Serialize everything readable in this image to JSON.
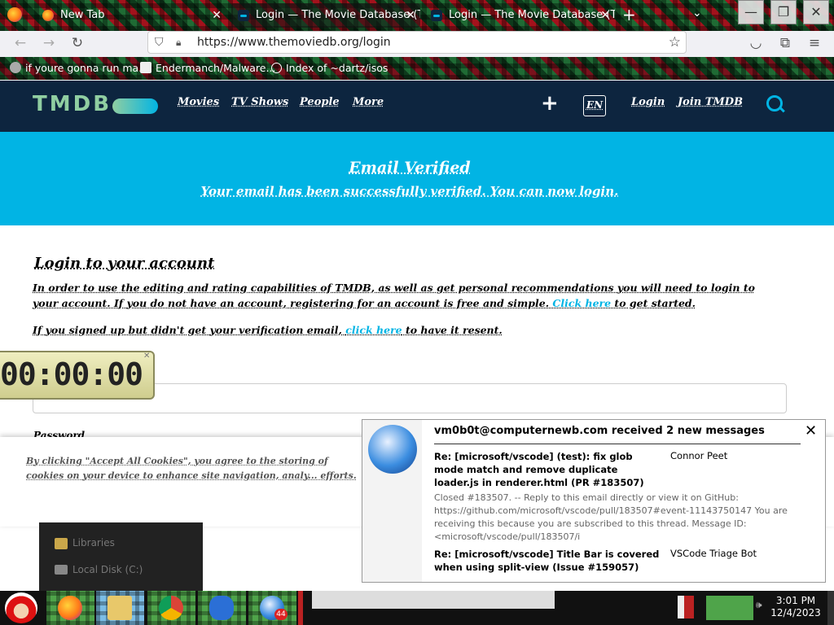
{
  "browser": {
    "tabs": [
      {
        "label": "New Tab",
        "icon": "firefox-icon"
      },
      {
        "label": "Login — The Movie Database (TMDB)",
        "icon": "tmdb-icon"
      },
      {
        "label": "Login — The Movie Database (TMDB)",
        "icon": "tmdb-icon"
      }
    ],
    "url": "https://www.themoviedb.org/login",
    "bookmarks": [
      {
        "label": "if youre gonna run ma..."
      },
      {
        "label": "Endermanch/Malware..."
      },
      {
        "label": "Index of ~dartz/isos"
      }
    ]
  },
  "site": {
    "logo": "TMDB",
    "nav": [
      "Movies",
      "TV Shows",
      "People",
      "More"
    ],
    "plus": "+",
    "lang": "EN",
    "login": "Login",
    "join": "Join TMDB"
  },
  "banner": {
    "title": "Email Verified",
    "message": "Your email has been successfully verified. You can now login."
  },
  "login": {
    "heading": "Login to your account",
    "desc_pre": "In order to use the editing and rating capabilities of TMDB, as well as get personal recommendations you will need to login to your account. If you do not have an account, registering for an account is free and simple.",
    "desc_link": "Click here",
    "desc_post": "to get started.",
    "resend_pre": "If you signed up but didn't get your verification email,",
    "resend_link": "click here",
    "resend_post": "to have it resent.",
    "password_label": "Password"
  },
  "cookie": {
    "text": "By clicking \"Accept All Cookies\", you agree to the storing of cookies on your device to enhance site navigation, analy... efforts."
  },
  "clock": {
    "time": "00:00:00"
  },
  "jumplist": [
    "Libraries",
    "Local Disk (C:)"
  ],
  "notification": {
    "title": "vm0b0t@computernewb.com received 2 new messages",
    "messages": [
      {
        "subject": "Re: [microsoft/vscode] (test): fix glob mode match and remove duplicate loader.js in renderer.html (PR #183507)",
        "from": "Connor Peet"
      },
      {
        "subject": "Re: [microsoft/vscode] Title Bar is covered when using split-view (Issue #159057)",
        "from": "VSCode Triage Bot"
      }
    ],
    "preview": "Closed #183507. -- Reply to this email directly or view it on GitHub: https://github.com/microsoft/vscode/pull/183507#event-11143750147 You are receiving this because you are subscribed to this thread. Message ID: <microsoft/vscode/pull/183507/i"
  },
  "taskbar": {
    "apps": [
      "firefox-icon",
      "file-explorer-icon",
      "chrome-icon",
      "visual-studio-icon",
      "thunderbird-icon"
    ],
    "thunderbird_badge": "44",
    "time": "3:01 PM",
    "date": "12/4/2023"
  },
  "colors": {
    "tmdb_dark": "#0d253f",
    "tmdb_blue": "#01b4e4",
    "tmdb_green": "#90cea1"
  }
}
